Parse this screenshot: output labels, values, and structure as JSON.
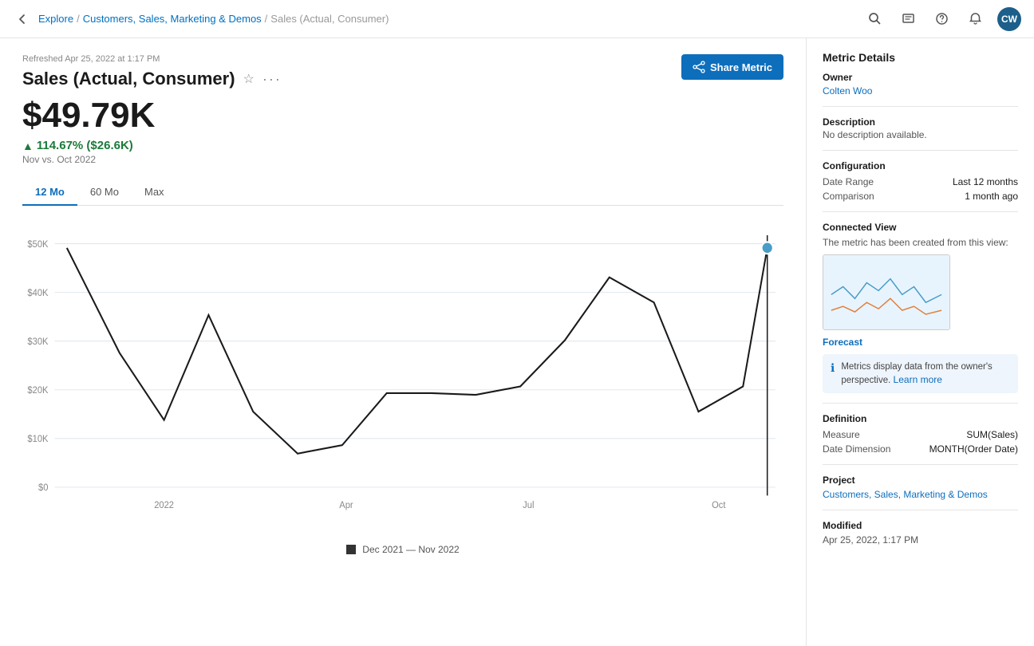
{
  "nav": {
    "back_label": "←",
    "breadcrumbs": [
      {
        "label": "Explore",
        "link": true
      },
      {
        "label": "/",
        "link": false
      },
      {
        "label": "Customers, Sales, Marketing & Demos",
        "link": true
      },
      {
        "label": "/",
        "link": false
      },
      {
        "label": "Sales (Actual, Consumer)",
        "link": false
      }
    ],
    "avatar": "CW"
  },
  "header": {
    "refreshed": "Refreshed Apr 25, 2022 at 1:17 PM",
    "title": "Sales (Actual, Consumer)",
    "value": "$49.79K",
    "change": "114.67% ($26.6K)",
    "comparison": "Nov vs. Oct 2022",
    "share_button": "Share Metric"
  },
  "tabs": [
    {
      "label": "12 Mo",
      "active": true
    },
    {
      "label": "60 Mo",
      "active": false
    },
    {
      "label": "Max",
      "active": false
    }
  ],
  "chart": {
    "y_labels": [
      "$50K",
      "$40K",
      "$30K",
      "$20K",
      "$10K",
      "$0"
    ],
    "x_labels": [
      "2022",
      "Apr",
      "Jul",
      "Oct"
    ],
    "legend_label": "Dec 2021 — Nov 2022"
  },
  "sidebar": {
    "metric_details_title": "Metric Details",
    "owner_label": "Owner",
    "owner_value": "Colten Woo",
    "description_label": "Description",
    "description_value": "No description available.",
    "configuration_label": "Configuration",
    "date_range_label": "Date Range",
    "date_range_value": "Last 12 months",
    "comparison_label": "Comparison",
    "comparison_value": "1 month ago",
    "connected_view_label": "Connected View",
    "connected_view_desc": "The metric has been created from this view:",
    "forecast_label": "Forecast",
    "info_text": "Metrics display data from the owner's perspective.",
    "learn_more": "Learn more",
    "definition_label": "Definition",
    "measure_label": "Measure",
    "measure_value": "SUM(Sales)",
    "date_dimension_label": "Date Dimension",
    "date_dimension_value": "MONTH(Order Date)",
    "project_label": "Project",
    "project_value": "Customers, Sales, Marketing & Demos",
    "modified_label": "Modified",
    "modified_value": "Apr 25, 2022, 1:17 PM"
  }
}
